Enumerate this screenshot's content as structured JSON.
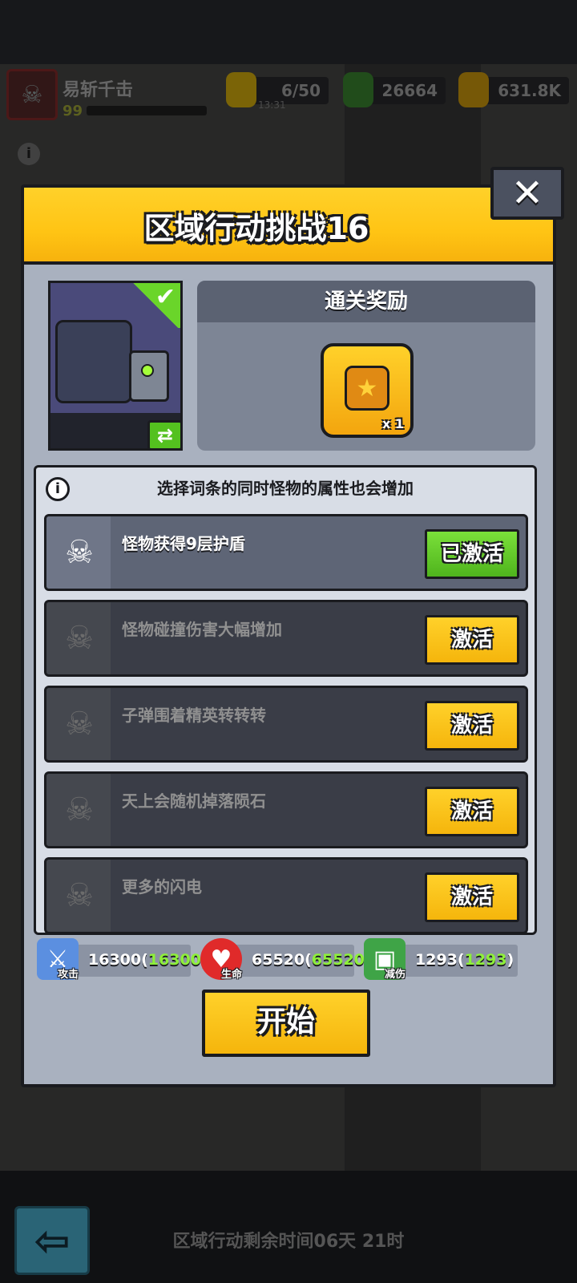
{
  "hud": {
    "player_name": "易斩千击",
    "player_level": "99",
    "energy": "6/50",
    "energy_timer": "13:31",
    "gems": "26664",
    "coins": "631.8K"
  },
  "dialog": {
    "title": "区域行动挑战16",
    "close_glyph": "✕",
    "reward": {
      "heading": "通关奖励",
      "quantity": "x 1"
    },
    "modifiers_note": "选择词条的同时怪物的属性也会增加",
    "modifiers": [
      {
        "text": "怪物获得9层护盾",
        "button": "已激活",
        "active": true
      },
      {
        "text": "怪物碰撞伤害大幅增加",
        "button": "激活",
        "active": false
      },
      {
        "text": "子弹围着精英转转转",
        "button": "激活",
        "active": false
      },
      {
        "text": "天上会随机掉落陨石",
        "button": "激活",
        "active": false
      },
      {
        "text": "更多的闪电",
        "button": "激活",
        "active": false
      }
    ],
    "stats": {
      "attack": {
        "label": "攻击",
        "value": "16300(",
        "bonus": "16300",
        "close": ")"
      },
      "health": {
        "label": "生命",
        "value": "65520(",
        "bonus": "65520",
        "close": ")"
      },
      "reduction": {
        "label": "减伤",
        "value": "1293(",
        "bonus": "1293",
        "close": ")"
      }
    },
    "start_label": "开始"
  },
  "footer": {
    "remaining_time": "区域行动剩余时间06天 21时"
  },
  "colors": {
    "accent_yellow": "#ffc414",
    "active_green": "#54c11f",
    "panel_gray": "#a9b1bf"
  },
  "icons": {
    "info": "info-icon",
    "close": "close-icon",
    "reward": "star-badge-icon",
    "modifier": "skull-mask-icon",
    "attack": "sword-icon",
    "health": "heart-icon",
    "reduction": "armor-icon"
  }
}
